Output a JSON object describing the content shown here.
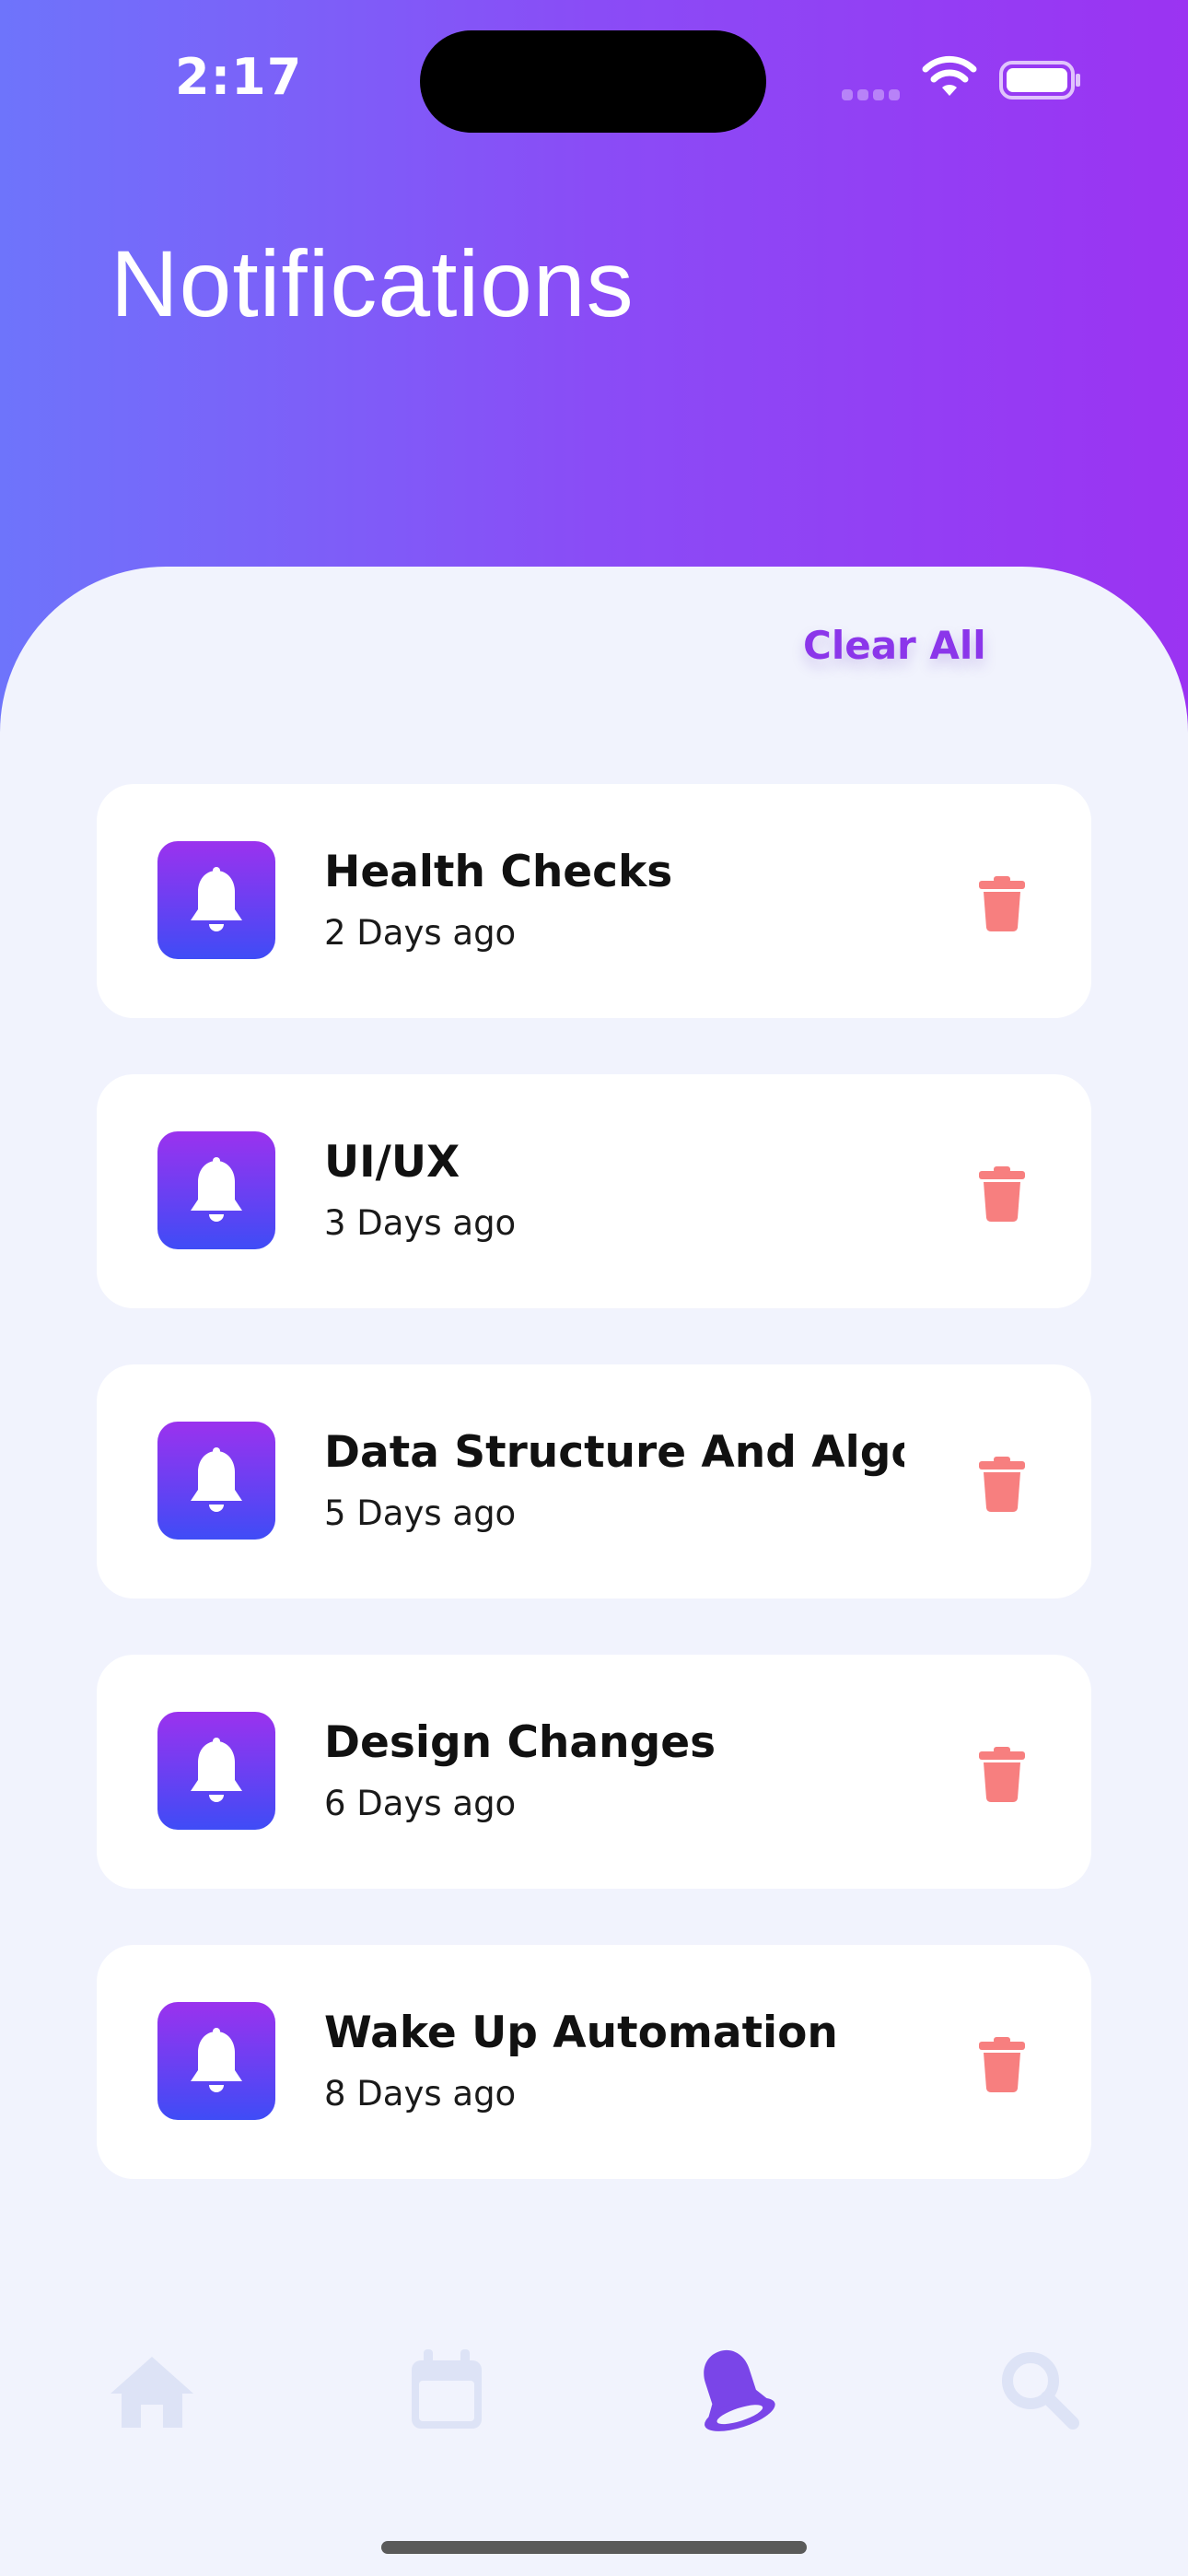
{
  "status_bar": {
    "time": "2:17"
  },
  "header": {
    "title": "Notifications"
  },
  "actions": {
    "clear_all_label": "Clear All"
  },
  "notifications": [
    {
      "title": "Health Checks",
      "time": "2 Days ago"
    },
    {
      "title": "UI/UX",
      "time": "3 Days ago"
    },
    {
      "title": "Data Structure And Algorithms",
      "time": "5 Days ago"
    },
    {
      "title": "Design Changes",
      "time": "6 Days ago"
    },
    {
      "title": "Wake Up Automation",
      "time": "8 Days ago"
    }
  ],
  "tab_bar": {
    "items": [
      {
        "icon": "home-icon",
        "active": false
      },
      {
        "icon": "calendar-icon",
        "active": false
      },
      {
        "icon": "bell-icon",
        "active": true
      },
      {
        "icon": "search-icon",
        "active": false
      }
    ]
  },
  "colors": {
    "header_gradient_start": "#6e74fb",
    "header_gradient_end": "#9b33f2",
    "accent": "#8b36ea",
    "delete": "#f77f7f",
    "tab_inactive": "#dde3f6",
    "background": "#f1f3fd"
  }
}
